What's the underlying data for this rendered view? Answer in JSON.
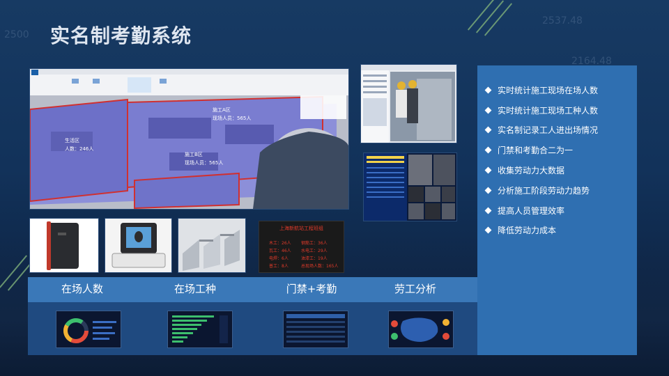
{
  "title": "实名制考勤系统",
  "features": [
    "实时统计施工现场在场人数",
    "实时统计施工现场工种人数",
    "实名制记录工人进出场情况",
    "门禁和考勤合二为一",
    "收集劳动力大数据",
    "分析施工阶段劳动力趋势",
    "提高人员管理效率",
    "降低劳动力成本"
  ],
  "categories": [
    "在场人数",
    "在场工种",
    "门禁+考勤",
    "劳工分析"
  ],
  "map_labels": {
    "zone_a": "施工A区",
    "zone_a_count": "现场人员：565人",
    "zone_b": "生活区",
    "zone_b_count": "人数：246人",
    "zone_c": "施工B区",
    "zone_c_count": "现场人员：565人"
  },
  "led_board": {
    "title": "上海新航站工程班组",
    "rows": [
      [
        "木工：26人",
        "钢筋工：36人"
      ],
      [
        "瓦工：46人",
        "水电工：29人"
      ],
      [
        "电焊：6人",
        "油漆工：19人"
      ],
      [
        "普工：8人",
        "总现场人数：165人"
      ]
    ]
  },
  "bg_numbers": [
    "2537.48",
    "2164.48",
    "2500"
  ],
  "colors": {
    "accent": "#2f6fb1",
    "band": "#3a78b8",
    "title": "#dfe6f0"
  }
}
